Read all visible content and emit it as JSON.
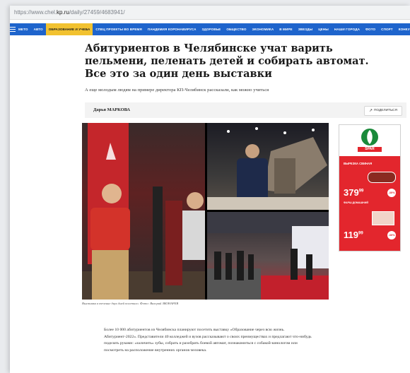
{
  "browser": {
    "url_prefix": "https://www.chel.",
    "url_domain": "kp.ru",
    "url_path": "/daily/27459/4683941/"
  },
  "nav": {
    "items": [
      "МЕТО",
      "АВТО",
      "ОБРАЗОВАНИЕ И УЧЕБА",
      "СПЕЦ ПРОЕКТЫ ВО ВРЕМЯ",
      "ПАНДЕМИЯ КОРОНАВИРУСА",
      "ЗДОРОВЬЕ",
      "ОБЩЕСТВО",
      "ЭКОНОМИКА",
      "В МИРЕ",
      "ЗВЕЗДЫ",
      "ЦЕНЫ",
      "НАШИ ГОРОДА",
      "ФОТО",
      "СПОРТ",
      "КОНКУРСЫ"
    ],
    "active_index": 2
  },
  "article": {
    "title": "Абитуриентов в Челябинске учат варить пельмени, пеленать детей и собирать автомат. Все это за один день выставки",
    "lead": "А еще молодым людям на примере директора КП-Челябинск рассказали, как можно учиться",
    "author": "Дарья МАРКОВА",
    "share_label": "ПОДЕЛИТЬСЯ",
    "photo_caption": "Выставка в течение двух дней посетило. Фото: Валерий ЗВОНАРЕВ",
    "body": "Более 10 000 абитуриентов из Челябинска планируют посетить выставку «Образование через всю жизнь. Абитуриент-2022». Представители 40 колледжей и вузов рассказывают о своих преимуществах и предлагают что-нибудь поделать руками: «заличить» зубы, собрать и разобрать боевой автомат, познакомиться с собакой-кинологом или посмотреть на расположение внутренних органов человека."
  },
  "ad": {
    "brand": "SPAR",
    "promo1_text": "ВЫРЕЗКА СВИНАЯ",
    "promo1_price": "379",
    "promo1_price_cents": "99",
    "promo1_badge": "-30%",
    "promo2_text": "ФАРШ ДОМАШНИЙ",
    "promo2_price": "119",
    "promo2_price_cents": "99",
    "promo2_badge": "-30%"
  },
  "colors": {
    "nav_bg": "#1e64cc",
    "nav_active": "#f2c230",
    "ad_red": "#e3262d",
    "spar_green": "#1a8a3a"
  }
}
